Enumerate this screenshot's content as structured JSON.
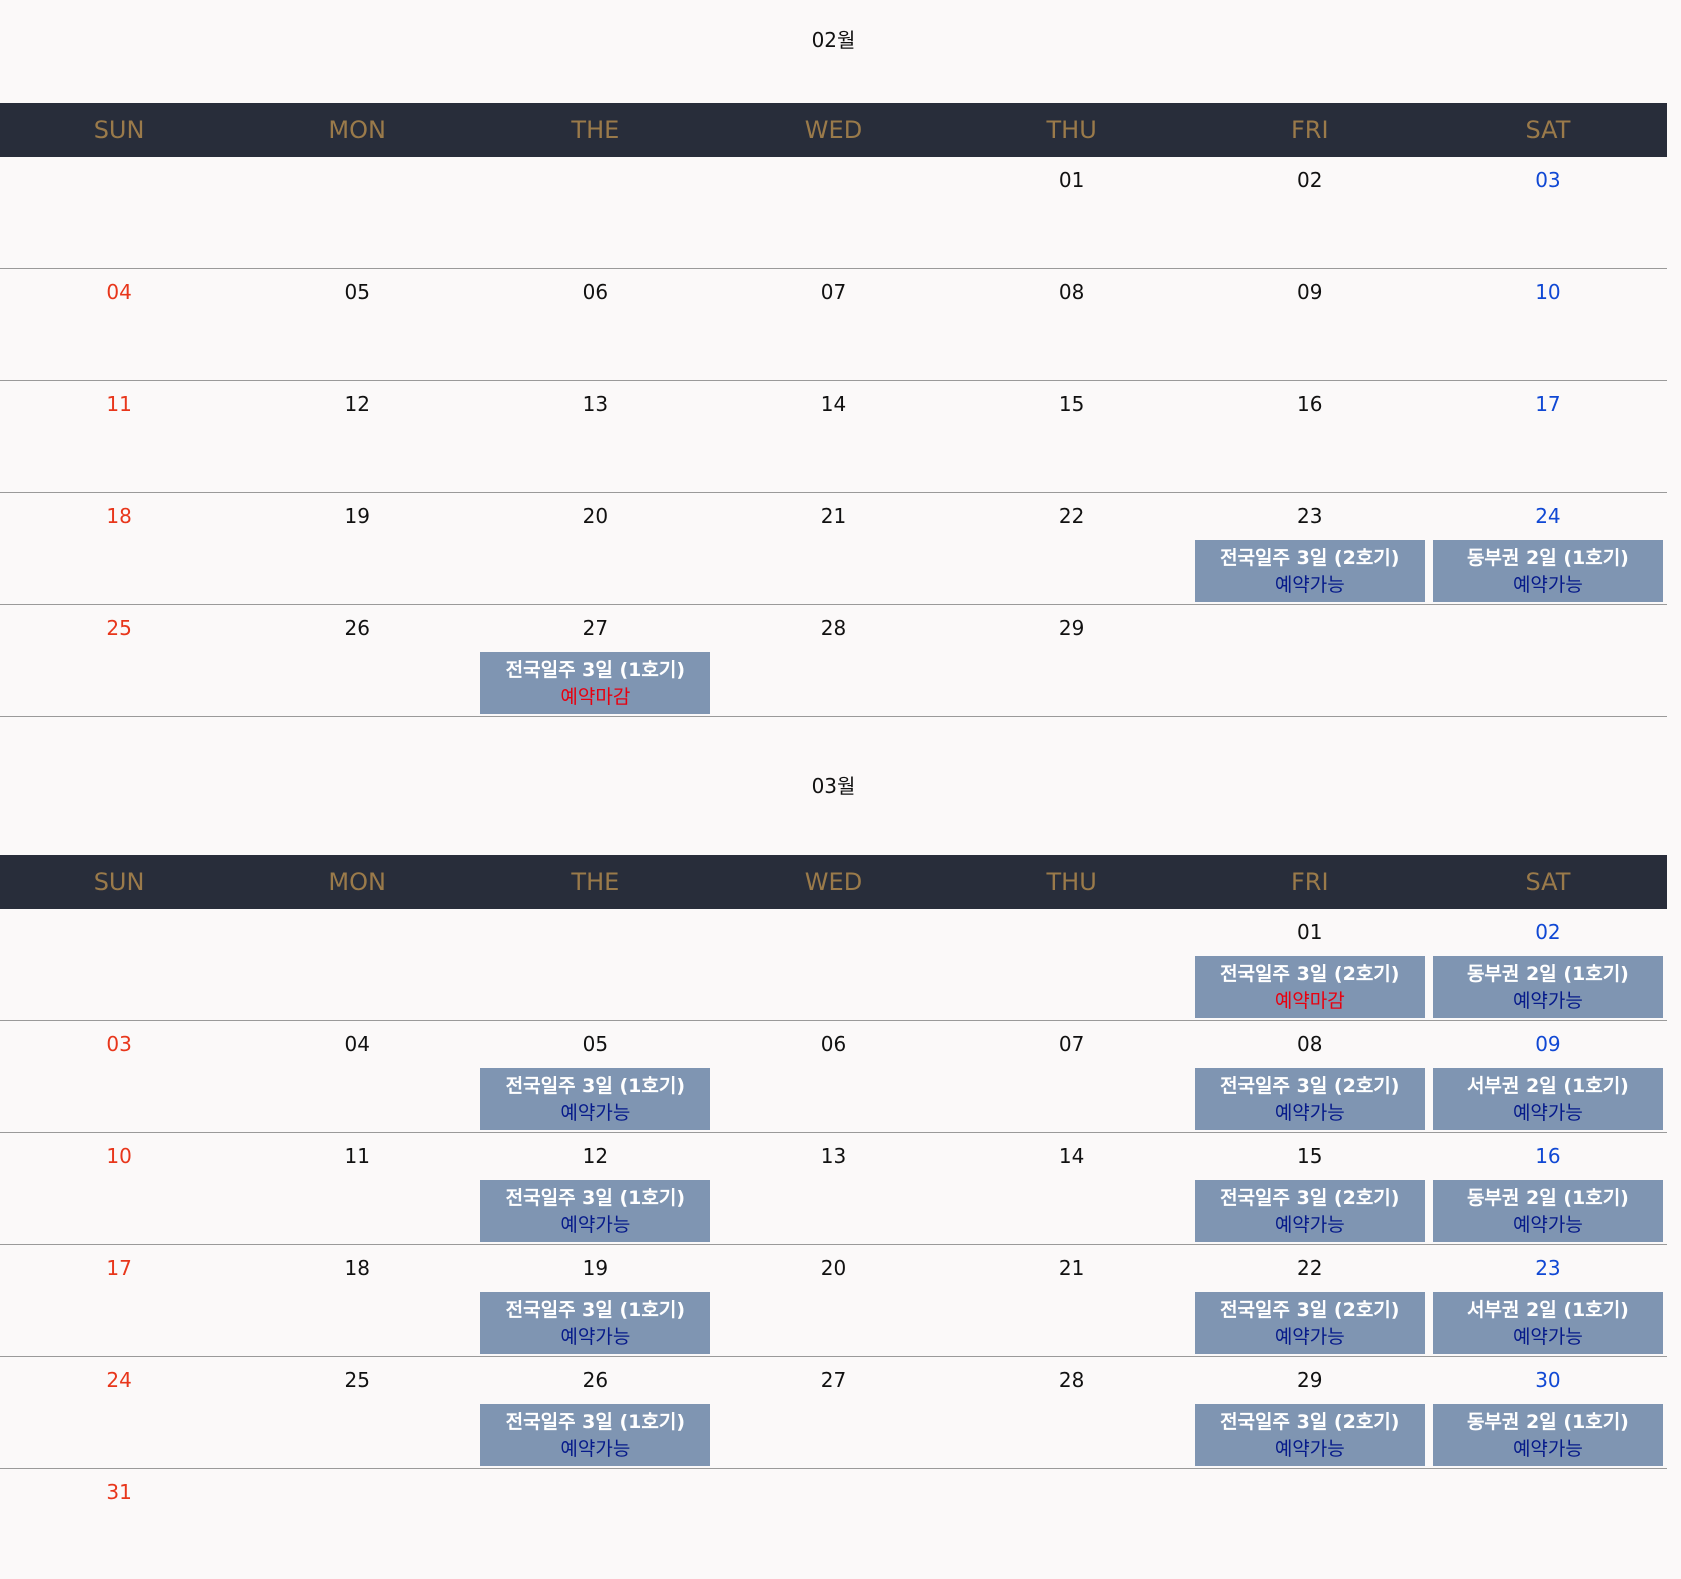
{
  "colors": {
    "header_bg": "#282d3a",
    "header_text": "#9a7a4a",
    "sunday": "#e8361b",
    "saturday": "#1048d4",
    "event_bg": "#7f95b2",
    "status_available": "#061a8a",
    "status_closed": "#e8000f"
  },
  "weekdays": [
    "SUN",
    "MON",
    "THE",
    "WED",
    "THU",
    "FRI",
    "SAT"
  ],
  "months": [
    {
      "title": "02월",
      "weeks": [
        [
          {
            "day": ""
          },
          {
            "day": ""
          },
          {
            "day": ""
          },
          {
            "day": ""
          },
          {
            "day": "01"
          },
          {
            "day": "02"
          },
          {
            "day": "03"
          }
        ],
        [
          {
            "day": "04"
          },
          {
            "day": "05"
          },
          {
            "day": "06"
          },
          {
            "day": "07"
          },
          {
            "day": "08"
          },
          {
            "day": "09"
          },
          {
            "day": "10"
          }
        ],
        [
          {
            "day": "11"
          },
          {
            "day": "12"
          },
          {
            "day": "13"
          },
          {
            "day": "14"
          },
          {
            "day": "15"
          },
          {
            "day": "16"
          },
          {
            "day": "17"
          }
        ],
        [
          {
            "day": "18"
          },
          {
            "day": "19"
          },
          {
            "day": "20"
          },
          {
            "day": "21"
          },
          {
            "day": "22"
          },
          {
            "day": "23",
            "event": {
              "title": "전국일주 3일 (2호기)",
              "status": "예약가능",
              "closed": false
            }
          },
          {
            "day": "24",
            "event": {
              "title": "동부권 2일 (1호기)",
              "status": "예약가능",
              "closed": false
            }
          }
        ],
        [
          {
            "day": "25"
          },
          {
            "day": "26"
          },
          {
            "day": "27",
            "event": {
              "title": "전국일주 3일 (1호기)",
              "status": "예약마감",
              "closed": true
            }
          },
          {
            "day": "28"
          },
          {
            "day": "29"
          },
          {
            "day": ""
          },
          {
            "day": ""
          }
        ]
      ]
    },
    {
      "title": "03월",
      "weeks": [
        [
          {
            "day": ""
          },
          {
            "day": ""
          },
          {
            "day": ""
          },
          {
            "day": ""
          },
          {
            "day": ""
          },
          {
            "day": "01",
            "event": {
              "title": "전국일주 3일 (2호기)",
              "status": "예약마감",
              "closed": true
            }
          },
          {
            "day": "02",
            "event": {
              "title": "동부권 2일 (1호기)",
              "status": "예약가능",
              "closed": false
            }
          }
        ],
        [
          {
            "day": "03"
          },
          {
            "day": "04"
          },
          {
            "day": "05",
            "event": {
              "title": "전국일주 3일 (1호기)",
              "status": "예약가능",
              "closed": false
            }
          },
          {
            "day": "06"
          },
          {
            "day": "07"
          },
          {
            "day": "08",
            "event": {
              "title": "전국일주 3일 (2호기)",
              "status": "예약가능",
              "closed": false
            }
          },
          {
            "day": "09",
            "event": {
              "title": "서부권 2일 (1호기)",
              "status": "예약가능",
              "closed": false
            }
          }
        ],
        [
          {
            "day": "10"
          },
          {
            "day": "11"
          },
          {
            "day": "12",
            "event": {
              "title": "전국일주 3일 (1호기)",
              "status": "예약가능",
              "closed": false
            }
          },
          {
            "day": "13"
          },
          {
            "day": "14"
          },
          {
            "day": "15",
            "event": {
              "title": "전국일주 3일 (2호기)",
              "status": "예약가능",
              "closed": false
            }
          },
          {
            "day": "16",
            "event": {
              "title": "동부권 2일 (1호기)",
              "status": "예약가능",
              "closed": false
            }
          }
        ],
        [
          {
            "day": "17"
          },
          {
            "day": "18"
          },
          {
            "day": "19",
            "event": {
              "title": "전국일주 3일 (1호기)",
              "status": "예약가능",
              "closed": false
            }
          },
          {
            "day": "20"
          },
          {
            "day": "21"
          },
          {
            "day": "22",
            "event": {
              "title": "전국일주 3일 (2호기)",
              "status": "예약가능",
              "closed": false
            }
          },
          {
            "day": "23",
            "event": {
              "title": "서부권 2일 (1호기)",
              "status": "예약가능",
              "closed": false
            }
          }
        ],
        [
          {
            "day": "24"
          },
          {
            "day": "25"
          },
          {
            "day": "26",
            "event": {
              "title": "전국일주 3일 (1호기)",
              "status": "예약가능",
              "closed": false
            }
          },
          {
            "day": "27"
          },
          {
            "day": "28"
          },
          {
            "day": "29",
            "event": {
              "title": "전국일주 3일 (2호기)",
              "status": "예약가능",
              "closed": false
            }
          },
          {
            "day": "30",
            "event": {
              "title": "동부권 2일 (1호기)",
              "status": "예약가능",
              "closed": false
            }
          }
        ],
        [
          {
            "day": "31"
          },
          {
            "day": ""
          },
          {
            "day": ""
          },
          {
            "day": ""
          },
          {
            "day": ""
          },
          {
            "day": ""
          },
          {
            "day": ""
          }
        ]
      ]
    }
  ]
}
